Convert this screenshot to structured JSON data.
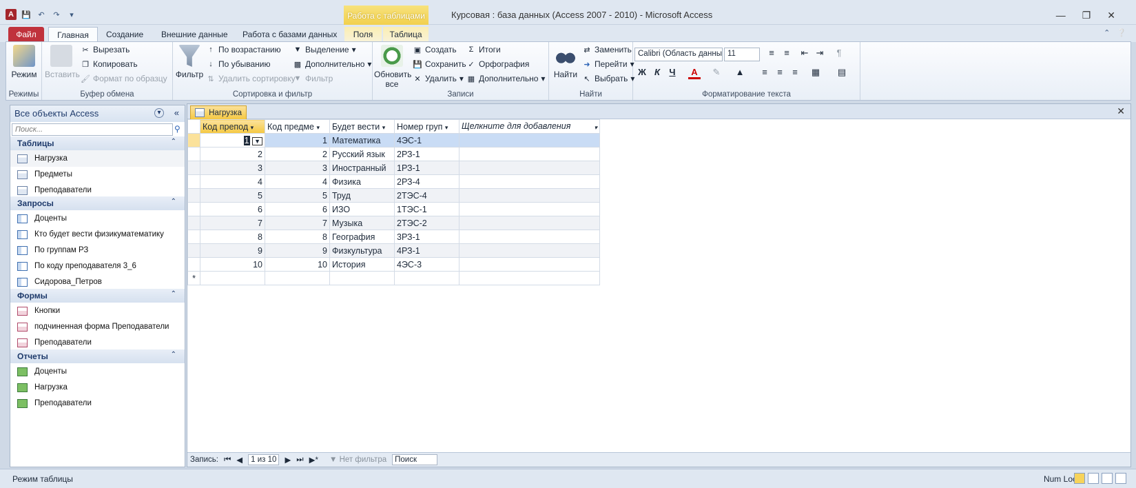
{
  "window": {
    "title": "Курсовая : база данных (Access 2007 - 2010)  -  Microsoft Access",
    "context_tab_group": "Работа с таблицами"
  },
  "ribbon_tabs": [
    "Файл",
    "Главная",
    "Создание",
    "Внешние данные",
    "Работа с базами данных",
    "Поля",
    "Таблица"
  ],
  "ribbon": {
    "views": {
      "mode": "Режим",
      "group": "Режимы"
    },
    "clipboard": {
      "paste": "Вставить",
      "cut": "Вырезать",
      "copy": "Копировать",
      "format_painter": "Формат по образцу",
      "group": "Буфер обмена"
    },
    "sort_filter": {
      "filter": "Фильтр",
      "asc": "По возрастанию",
      "desc": "По убыванию",
      "remove_sort": "Удалить сортировку",
      "selection": "Выделение",
      "advanced": "Дополнительно",
      "toggle_filter": "Фильтр",
      "group": "Сортировка и фильтр"
    },
    "records": {
      "refresh": "Обновить все",
      "new": "Создать",
      "save": "Сохранить",
      "delete": "Удалить",
      "totals": "Итоги",
      "spelling": "Орфография",
      "more": "Дополнительно",
      "group": "Записи"
    },
    "find": {
      "find": "Найти",
      "replace": "Заменить",
      "goto": "Перейти",
      "select": "Выбрать",
      "group": "Найти"
    },
    "text_format": {
      "font": "Calibri (Область данны",
      "size": "11",
      "bold": "Ж",
      "italic": "К",
      "underline": "Ч",
      "group": "Форматирование текста"
    }
  },
  "nav": {
    "header": "Все объекты Access",
    "search_placeholder": "Поиск...",
    "sections": [
      {
        "title": "Таблицы",
        "items": [
          "Нагрузка",
          "Предметы",
          "Преподаватели"
        ]
      },
      {
        "title": "Запросы",
        "items": [
          "Доценты",
          "Кто будет вести физикуматематику",
          "По группам РЗ",
          "По коду преподавателя 3_6",
          "Сидорова_Петров"
        ]
      },
      {
        "title": "Формы",
        "items": [
          "Кнопки",
          "подчиненная форма Преподаватели",
          "Преподаватели"
        ]
      },
      {
        "title": "Отчеты",
        "items": [
          "Доценты",
          "Нагрузка",
          "Преподаватели"
        ]
      }
    ]
  },
  "document": {
    "tab": "Нагрузка",
    "columns": [
      "Код препод",
      "Код предме",
      "Будет вести",
      "Номер груп",
      "Щелкните для добавления"
    ],
    "rows": [
      [
        "1",
        "1",
        "Математика",
        "4ЭС-1"
      ],
      [
        "2",
        "2",
        "Русский язык",
        "2РЗ-1"
      ],
      [
        "3",
        "3",
        "Иностранный",
        "1РЗ-1"
      ],
      [
        "4",
        "4",
        "Физика",
        "2РЗ-4"
      ],
      [
        "5",
        "5",
        "Труд",
        "2ТЭС-4"
      ],
      [
        "6",
        "6",
        "ИЗО",
        "1ТЭС-1"
      ],
      [
        "7",
        "7",
        "Музыка",
        "2ТЭС-2"
      ],
      [
        "8",
        "8",
        "География",
        "3РЗ-1"
      ],
      [
        "9",
        "9",
        "Физкультура",
        "4РЗ-1"
      ],
      [
        "10",
        "10",
        "История",
        "4ЭС-3"
      ]
    ],
    "new_row_marker": "*",
    "record_nav": {
      "label": "Запись:",
      "position": "1 из 10",
      "filter": "Нет фильтра",
      "search": "Поиск"
    }
  },
  "status": {
    "left": "Режим таблицы",
    "right": "Num Lock"
  },
  "colors": {
    "accent_file_tab": "#c0323c",
    "context_tab": "#f5c842",
    "selection_row": "#c9dcf5"
  }
}
